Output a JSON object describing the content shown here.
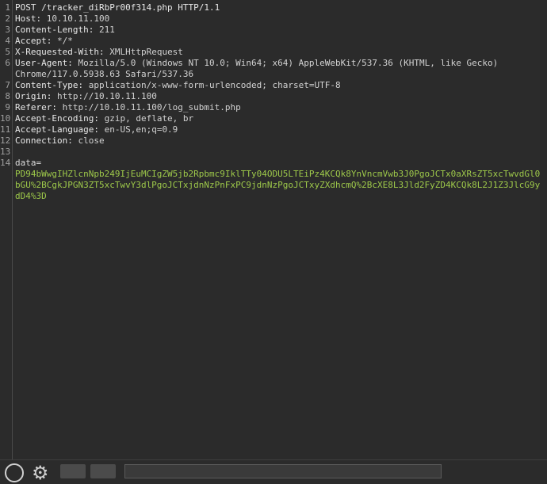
{
  "request": {
    "request_line": "POST /tracker_diRbPr00f314.php HTTP/1.1",
    "headers": [
      {
        "name": "Host:",
        "value": " 10.10.11.100"
      },
      {
        "name": "Content-Length:",
        "value": " 211"
      },
      {
        "name": "Accept:",
        "value": " */*"
      },
      {
        "name": "X-Requested-With:",
        "value": " XMLHttpRequest"
      },
      {
        "name": "User-Agent:",
        "value": " Mozilla/5.0 (Windows NT 10.0; Win64; x64) AppleWebKit/537.36 (KHTML, like Gecko)",
        "continuation": "Chrome/117.0.5938.63 Safari/537.36"
      },
      {
        "name": "Content-Type:",
        "value": " application/x-www-form-urlencoded; charset=UTF-8"
      },
      {
        "name": "Origin:",
        "value": " http://10.10.11.100"
      },
      {
        "name": "Referer:",
        "value": " http://10.10.11.100/log_submit.php"
      },
      {
        "name": "Accept-Encoding:",
        "value": " gzip, deflate, br"
      },
      {
        "name": "Accept-Language:",
        "value": " en-US,en;q=0.9"
      },
      {
        "name": "Connection:",
        "value": " close"
      }
    ],
    "body_param_name": "data=",
    "body_param_value": "PD94bWwgIHZlcnNpb249IjEuMCIgZW5jb2Rpbmc9IklTTy04ODU5LTEiPz4KCQk8YnVncmVwb3J0PgoJCTx0aXRsZT5xcTwvdGl0bGU%2BCgkJPGN3ZT5xcTwvY3dlPgoJCTxjdnNzPnFxPC9jdnNzPgoJCTxyZXdhcmQ%2BcXE8L3Jld2FyZD4KCQk8L2J1Z3JlcG9ydD4%3D"
  },
  "line_numbers": [
    "1",
    "2",
    "3",
    "4",
    "5",
    "6",
    "7",
    "8",
    "9",
    "10",
    "11",
    "12",
    "13",
    "14"
  ],
  "colors": {
    "background": "#2b2b2b",
    "text": "#dcdcdc",
    "param_value": "#9ec94a",
    "line_number": "#a0a0a0"
  },
  "icons": {
    "help": "help-icon",
    "settings": "gear-icon"
  }
}
